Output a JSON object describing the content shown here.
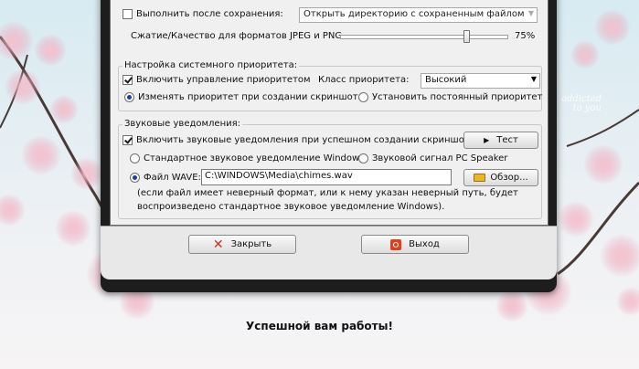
{
  "settings": {
    "row0_label": "",
    "after_save_label": "Выполнить после сохранения:",
    "after_save_value": "Открыть директорию с сохраненным файлом",
    "compression_label": "Сжатие/Качество для форматов JPEG и PNG",
    "compression_percent": 75,
    "compression_text": "75%"
  },
  "priority": {
    "group_label": "Настройка системного приоритета:",
    "enable_label": "Включить управление приоритетом",
    "class_label": "Класс приоритета:",
    "class_value": "Высокий",
    "radio_change": "Изменять приоритет при создании скриншота",
    "radio_fixed": "Установить постоянный приоритет"
  },
  "sound": {
    "group_label": "Звуковые уведомления:",
    "enable_label": "Включить звуковые уведомления при успешном создании скриншота",
    "test_button": "Тест",
    "radio_standard": "Стандартное звуковое уведомление Windows",
    "radio_speaker": "Звуковой сигнал PC Speaker",
    "radio_wave": "Файл WAVE:",
    "wave_path": "C:\\WINDOWS\\Media\\chimes.wav",
    "browse_button": "Обзор...",
    "note_line1": "(если файл имеет неверный формат, или к нему указан неверный путь, будет",
    "note_line2": "воспроизведено стандартное звуковое уведомление Windows)."
  },
  "buttons": {
    "close": "Закрыть",
    "exit": "Выход"
  },
  "footer": {
    "message": "Успешной вам работы!"
  },
  "watermark": {
    "line1": "addicted",
    "line2": "to you"
  },
  "colors": {
    "close_x": "#d8281e",
    "exit_icon": "#e0401a"
  }
}
